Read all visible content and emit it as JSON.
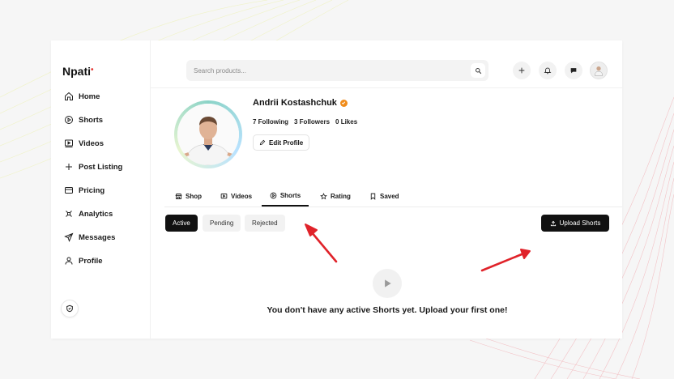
{
  "app": {
    "logo": "Npati",
    "logo_dot": "•"
  },
  "sidebar": {
    "items": [
      {
        "label": "Home",
        "icon": "home-icon"
      },
      {
        "label": "Shorts",
        "icon": "play-circle-icon"
      },
      {
        "label": "Videos",
        "icon": "video-icon"
      },
      {
        "label": "Post Listing",
        "icon": "plus-icon"
      },
      {
        "label": "Pricing",
        "icon": "card-icon"
      },
      {
        "label": "Analytics",
        "icon": "analytics-icon"
      },
      {
        "label": "Messages",
        "icon": "send-icon"
      },
      {
        "label": "Profile",
        "icon": "user-icon"
      }
    ]
  },
  "search": {
    "placeholder": "Search products..."
  },
  "profile": {
    "name": "Andrii Kostashchuk",
    "following": "7 Following",
    "followers": "3 Followers",
    "likes": "0 Likes",
    "edit_label": "Edit Profile"
  },
  "tabs": [
    {
      "label": "Shop"
    },
    {
      "label": "Videos"
    },
    {
      "label": "Shorts",
      "active": true
    },
    {
      "label": "Rating"
    },
    {
      "label": "Saved"
    }
  ],
  "filters": [
    {
      "label": "Active",
      "active": true
    },
    {
      "label": "Pending"
    },
    {
      "label": "Rejected"
    }
  ],
  "upload_label": "Upload Shorts",
  "empty_message": "You don't have any active Shorts yet. Upload your first one!",
  "colors": {
    "accent": "#e53935",
    "verified": "#f08c1b",
    "primary_button": "#111111",
    "annotation_arrow": "#e0232a"
  }
}
